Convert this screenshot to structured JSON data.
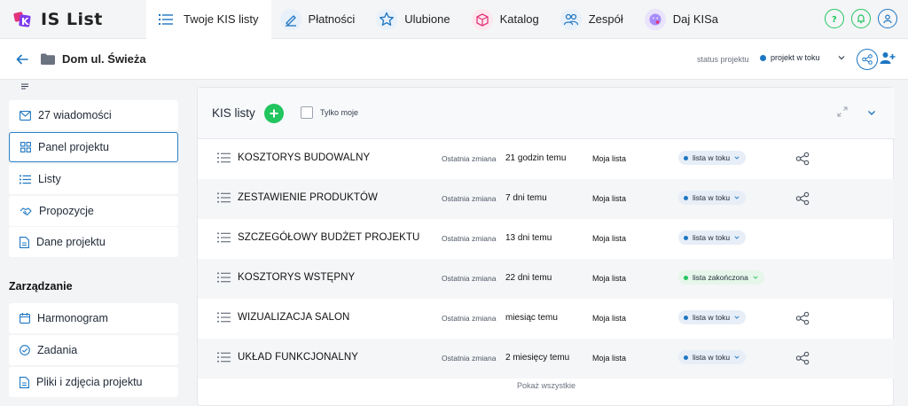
{
  "app": {
    "logo_prefix": "K",
    "logo_text": "IS List"
  },
  "nav": [
    {
      "label": "Twoje KIS listy",
      "icon": "list-icon",
      "active": true
    },
    {
      "label": "Płatności",
      "icon": "payments-icon"
    },
    {
      "label": "Ulubione",
      "icon": "star-icon"
    },
    {
      "label": "Katalog",
      "icon": "catalog-icon"
    },
    {
      "label": "Zespół",
      "icon": "team-icon"
    },
    {
      "label": "Daj KISa",
      "icon": "kiss-icon"
    }
  ],
  "project": {
    "name": "Dom ul. Świeża",
    "status_label": "status projektu",
    "status_value": "projekt w toku"
  },
  "sidebar": {
    "items": [
      {
        "label": "27 wiadomości",
        "icon": "mail-icon"
      },
      {
        "label": "Panel projektu",
        "icon": "grid-icon",
        "active": true
      },
      {
        "label": "Listy",
        "icon": "list-icon"
      },
      {
        "label": "Propozycje",
        "icon": "handshake-icon"
      },
      {
        "label": "Dane projektu",
        "icon": "document-icon"
      }
    ],
    "section_title": "Zarządzanie",
    "management": [
      {
        "label": "Harmonogram",
        "icon": "calendar-icon"
      },
      {
        "label": "Zadania",
        "icon": "check-circle-icon"
      },
      {
        "label": "Pliki i zdjęcia projektu",
        "icon": "file-icon"
      }
    ]
  },
  "main": {
    "title": "KIS listy",
    "only_mine": "Tylko moje",
    "last_change_label": "Ostatnia zmiana",
    "show_all": "Pokaż wszystkie",
    "rows": [
      {
        "name": "KOSZTORYS BUDOWALNY",
        "last_change": "21 godzin temu",
        "owner": "Moja lista",
        "status": "lista w toku",
        "shared": true
      },
      {
        "name": "ZESTAWIENIE PRODUKTÓW",
        "last_change": "7 dni temu",
        "owner": "Moja lista",
        "status": "lista w toku",
        "shared": true
      },
      {
        "name": "SZCZEGÓŁOWY BUDŻET PROJEKTU",
        "last_change": "13 dni temu",
        "owner": "Moja lista",
        "status": "lista w toku",
        "shared": false
      },
      {
        "name": "KOSZTORYS WSTĘPNY",
        "last_change": "22 dni temu",
        "owner": "Moja lista",
        "status": "lista zakończona",
        "shared": false
      },
      {
        "name": "WIZUALIZACJA SALON",
        "last_change": "miesiąc temu",
        "owner": "Moja lista",
        "status": "lista w toku",
        "shared": true
      },
      {
        "name": "UKŁAD FUNKCJONALNY",
        "last_change": "2 miesięcy temu",
        "owner": "Moja lista",
        "status": "lista w toku",
        "shared": true
      }
    ]
  },
  "colors": {
    "accent": "#1d76c2",
    "green": "#22c55e",
    "logo_pink": "#e2337b"
  }
}
